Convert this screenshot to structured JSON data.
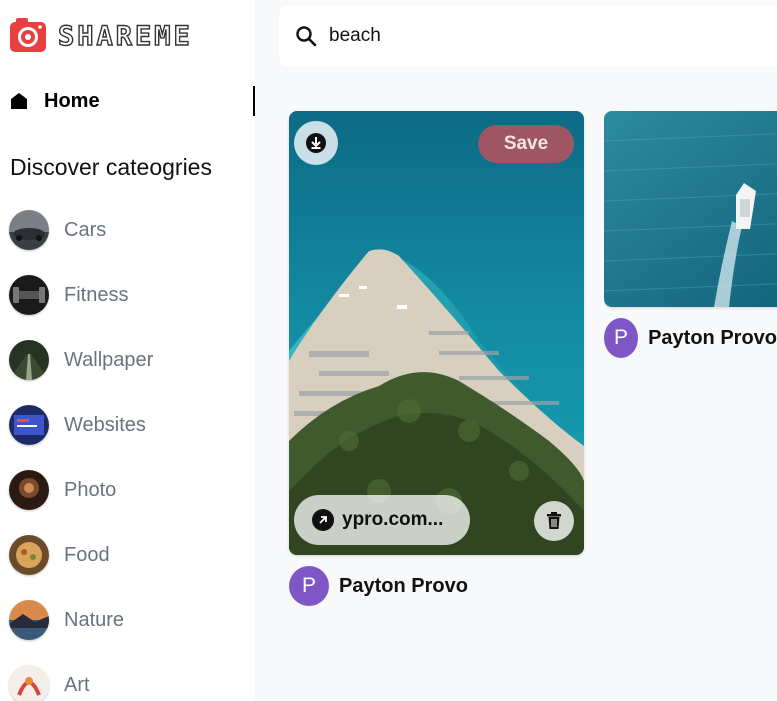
{
  "app": {
    "logo_text": "SHAREME"
  },
  "sidebar": {
    "home_label": "Home",
    "discover_title": "Discover cateogries",
    "categories": [
      {
        "label": "Cars"
      },
      {
        "label": "Fitness"
      },
      {
        "label": "Wallpaper"
      },
      {
        "label": "Websites"
      },
      {
        "label": "Photo"
      },
      {
        "label": "Food"
      },
      {
        "label": "Nature"
      },
      {
        "label": "Art"
      }
    ]
  },
  "search": {
    "value": "beach"
  },
  "pins": [
    {
      "save_label": "Save",
      "link_text": "ypro.com...",
      "author_initial": "P",
      "author_name": "Payton Provo"
    },
    {
      "author_initial": "P",
      "author_name": "Payton Provo"
    }
  ],
  "colors": {
    "brand_red": "#e8403f",
    "save_button": "#be505a",
    "avatar": "#7e56c6"
  }
}
